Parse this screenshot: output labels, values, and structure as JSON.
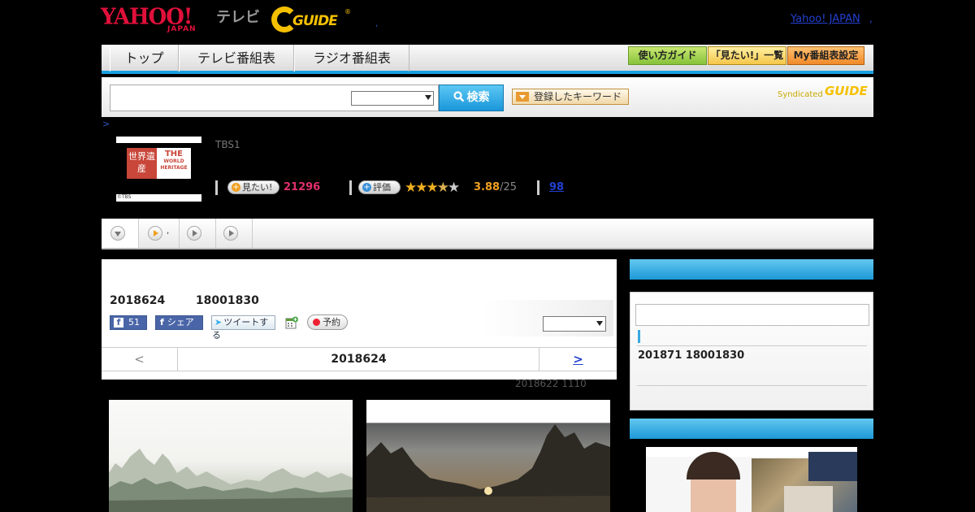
{
  "header": {
    "yahoo_logo": "YAHOO!",
    "yahoo_logo_sub": "JAPAN",
    "tv_label": "テレビ",
    "gguide_logo": "GUIDE",
    "gguide_mark": "®",
    "separator": ",",
    "yahoo_japan_link": "Yahoo! JAPAN",
    "separator2": ","
  },
  "nav": {
    "tabs": [
      {
        "label": "トップ"
      },
      {
        "label": "テレビ番組表"
      },
      {
        "label": "ラジオ番組表"
      }
    ],
    "buttons": {
      "guide": "使い方ガイド",
      "mitai_list": "「見たい!」一覧",
      "my_settings": "My番組表設定"
    }
  },
  "search": {
    "input_value": "",
    "select_value": "",
    "search_button": "検索",
    "keyword_button": "登録したキーワード",
    "syndicated": "Syndicated",
    "syndicated_logo": "GUIDE"
  },
  "breadcrumb": ">",
  "program": {
    "thumb": {
      "jp": "世界遺産",
      "en_line1": "THE",
      "en_line2": "WORLD",
      "en_line3": "HERITAGE",
      "credit": "©TBS"
    },
    "station": "TBS1",
    "mitai_button": "見たい!",
    "mitai_count": "21296",
    "rate_button": "評価",
    "stars_filled": "★★★",
    "stars_half": "★",
    "stars_empty": "★",
    "rating": "3.88",
    "rating_suffix": "/25",
    "review_count": "98"
  },
  "tabs_bar": {
    "tab2_label": ","
  },
  "main": {
    "title": "2018624 　　 18001830",
    "fb_like_count": "51",
    "fb_share": "シェア",
    "tweet": "ツイートする",
    "reserve": "予約",
    "select_value": "",
    "prev": "<",
    "date": "2018624",
    "next": ">",
    "updated": "2018622  1110"
  },
  "sidebar": {
    "box1_input": "",
    "next_broadcast": "201871  18001830"
  }
}
